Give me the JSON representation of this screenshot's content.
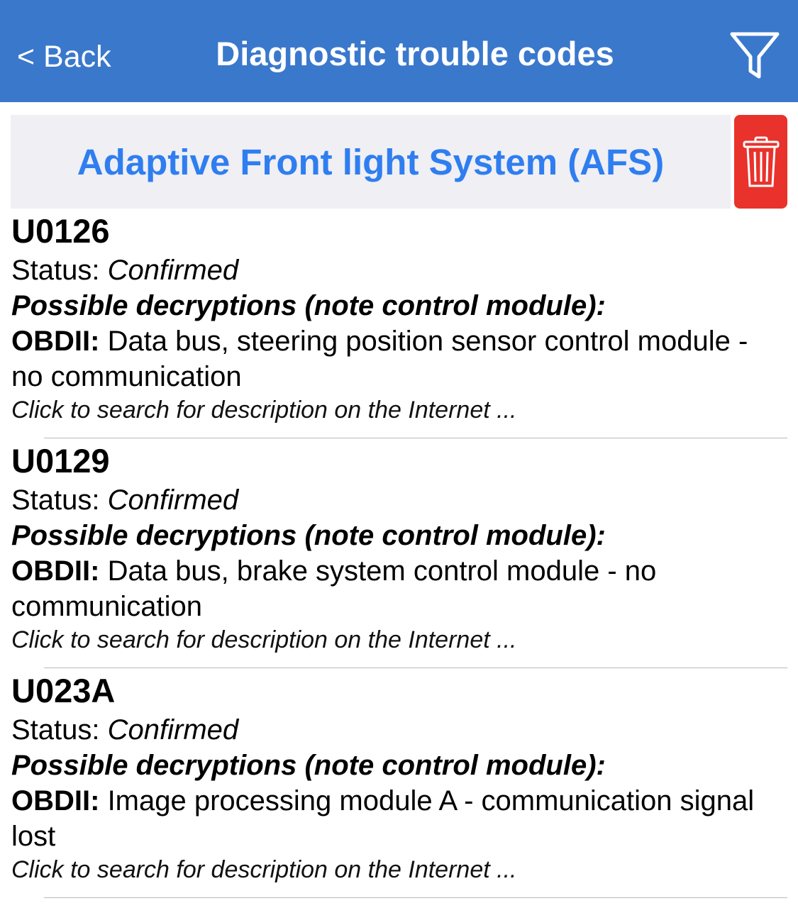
{
  "nav": {
    "back_label": "< Back",
    "title": "Diagnostic trouble codes",
    "filter_icon": "filter-icon"
  },
  "section": {
    "title": "Adaptive Front light System (AFS)",
    "delete_icon": "trash-icon",
    "delete_color": "#e8322b"
  },
  "theme": {
    "nav_bg": "#3a78cc",
    "header_bg": "#efeff4",
    "accent": "#2f7ef0"
  },
  "dtcs": [
    {
      "code": "U0126",
      "status_label": "Status:",
      "status_value": "Confirmed",
      "decryptions_label": "Possible decryptions (note control module):",
      "obd_label": "OBDII:",
      "description": "Data bus, steering position sensor control module - no communication",
      "search_hint": "Click to search for description on the Internet ..."
    },
    {
      "code": "U0129",
      "status_label": "Status:",
      "status_value": "Confirmed",
      "decryptions_label": "Possible decryptions (note control module):",
      "obd_label": "OBDII:",
      "description": "Data bus, brake system control module - no communication",
      "search_hint": "Click to search for description on the Internet ..."
    },
    {
      "code": "U023A",
      "status_label": "Status:",
      "status_value": "Confirmed",
      "decryptions_label": "Possible decryptions (note control module):",
      "obd_label": "OBDII:",
      "description": "Image processing module A - communication signal lost",
      "search_hint": "Click to search for description on the Internet ..."
    }
  ]
}
